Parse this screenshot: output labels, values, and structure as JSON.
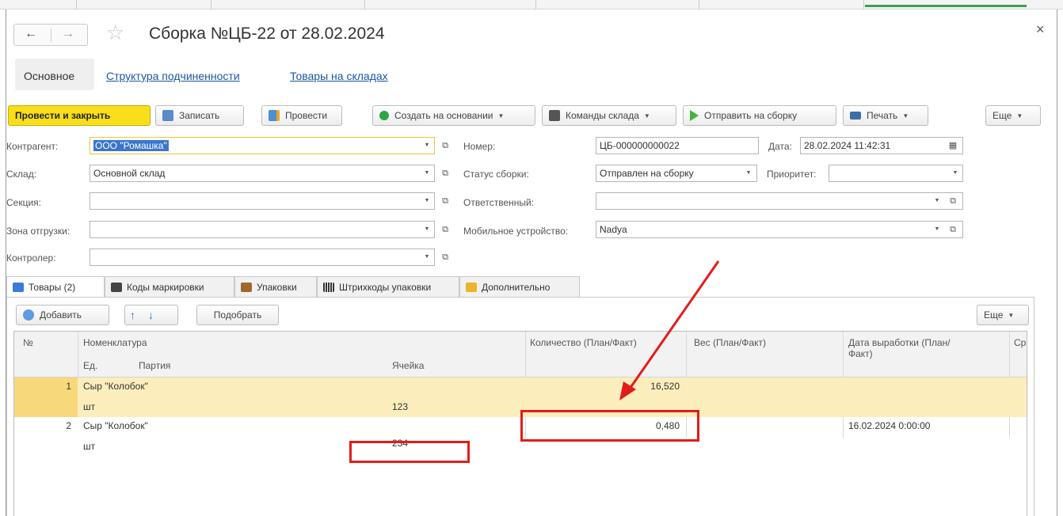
{
  "header": {
    "title": "Сборка №ЦБ-22 от 28.02.2024",
    "back_glyph": "←",
    "forward_glyph": "→",
    "star_glyph": "☆",
    "close_glyph": "×"
  },
  "nav": {
    "current": "Основное",
    "links": [
      "Структура подчиненности",
      "Товары на складах"
    ]
  },
  "toolbar": {
    "post_and_close": "Провести и закрыть",
    "save": "Записать",
    "post": "Провести",
    "create_based": "Создать на основании",
    "warehouse_commands": "Команды склада",
    "send_to_assembly": "Отправить на сборку",
    "print": "Печать",
    "more": "Еще"
  },
  "form": {
    "counterparty": {
      "label": "Контрагент:",
      "value": "ООО \"Ромашка\""
    },
    "warehouse": {
      "label": "Склад:",
      "value": "Основной склад"
    },
    "section": {
      "label": "Секция:",
      "value": ""
    },
    "shipping_zone": {
      "label": "Зона отгрузки:",
      "value": ""
    },
    "controller": {
      "label": "Контролер:",
      "value": ""
    },
    "number": {
      "label": "Номер:",
      "value": "ЦБ-000000000022"
    },
    "date": {
      "label": "Дата:",
      "value": "28.02.2024 11:42:31"
    },
    "assembly_status": {
      "label": "Статус сборки:",
      "value": "Отправлен на сборку"
    },
    "priority": {
      "label": "Приоритет:",
      "value": ""
    },
    "responsible": {
      "label": "Ответственный:",
      "value": ""
    },
    "mobile_device": {
      "label": "Мобильное устройство:",
      "value": "Nadya"
    }
  },
  "tabs": [
    "Товары (2)",
    "Коды маркировки",
    "Упаковки",
    "Штрихкоды упаковки",
    "Дополнительно"
  ],
  "table_toolbar": {
    "add": "Добавить",
    "pick": "Подобрать",
    "more": "Еще"
  },
  "table": {
    "headers": {
      "no": "№",
      "nomenclature": "Номенклатура",
      "unit": "Ед.",
      "batch": "Партия",
      "cell": "Ячейка",
      "qty": "Количество (План/Факт)",
      "weight": "Вес (План/Факт)",
      "prod_date": "Дата выработки (План/Факт)",
      "cut": "Ср"
    },
    "rows": [
      {
        "no": "1",
        "name": "Сыр \"Колобок\"",
        "unit": "шт",
        "cell": "123",
        "qty": "16,520",
        "prod_date": ""
      },
      {
        "no": "2",
        "name": "Сыр \"Колобок\"",
        "unit": "шт",
        "cell": "234",
        "qty": "0,480",
        "prod_date": "16.02.2024 0:00:00"
      }
    ]
  },
  "colors": {
    "primary_button": "#f8de1b",
    "link": "#1a56a8",
    "selected_row": "#fbeebc",
    "annotation": "#e51b1b"
  }
}
